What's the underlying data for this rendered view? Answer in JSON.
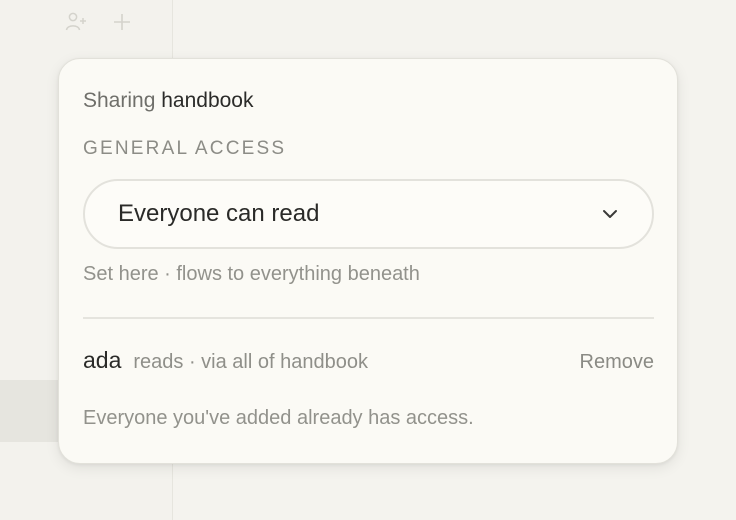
{
  "background": {
    "toolbar": {
      "add_person_icon": "person-plus-icon",
      "add_icon": "plus-icon"
    }
  },
  "dialog": {
    "title_prefix": "Sharing",
    "doc_name": "handbook",
    "general_access": {
      "label": "GENERAL ACCESS",
      "selected_value": "Everyone can read",
      "helper": "Set here · flows to everything beneath"
    },
    "members": [
      {
        "name": "ada",
        "detail": "reads · via all of handbook",
        "action_label": "Remove"
      }
    ],
    "footer_note": "Everyone you've added already has access."
  },
  "colors": {
    "background": "#f2f1ec",
    "dialog": "#fbfaf5",
    "text_primary": "#2a2a28",
    "text_muted": "#92928c"
  }
}
